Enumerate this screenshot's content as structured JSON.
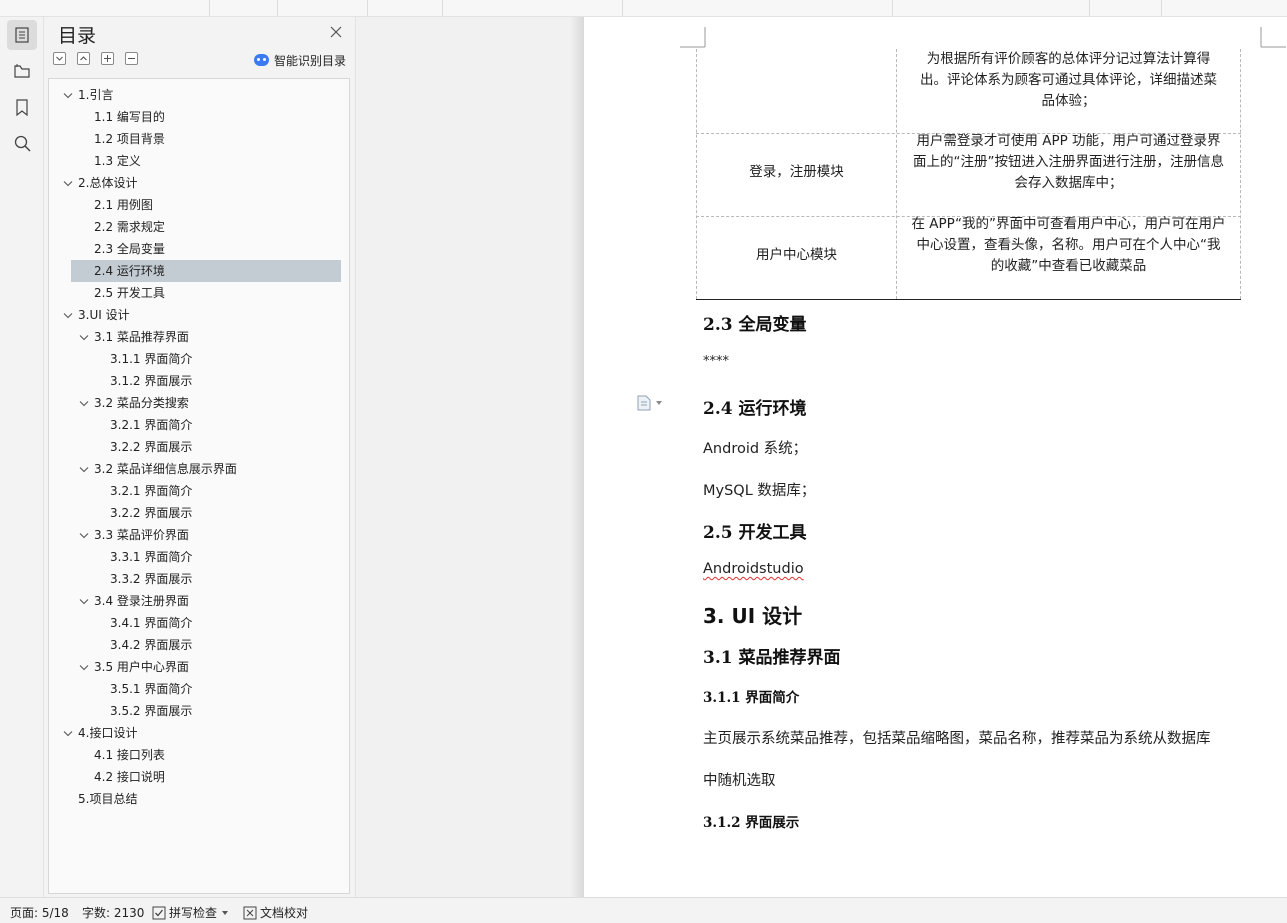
{
  "toc": {
    "title": "目录",
    "smart_label": "智能识别目录",
    "items": [
      {
        "label": "1.引言",
        "level": 0,
        "expanded": true
      },
      {
        "label": "1.1 编写目的",
        "level": 1
      },
      {
        "label": "1.2 项目背景",
        "level": 1
      },
      {
        "label": "1.3 定义",
        "level": 1
      },
      {
        "label": "2.总体设计",
        "level": 0,
        "expanded": true
      },
      {
        "label": "2.1 用例图",
        "level": 1
      },
      {
        "label": "2.2 需求规定",
        "level": 1
      },
      {
        "label": "2.3 全局变量",
        "level": 1
      },
      {
        "label": "2.4 运行环境",
        "level": 1,
        "selected": true
      },
      {
        "label": "2.5 开发工具",
        "level": 1
      },
      {
        "label": "3.UI 设计",
        "level": 0,
        "expanded": true
      },
      {
        "label": "3.1 菜品推荐界面",
        "level": 1,
        "expanded": true
      },
      {
        "label": "3.1.1 界面简介",
        "level": 2
      },
      {
        "label": "3.1.2 界面展示",
        "level": 2
      },
      {
        "label": "3.2 菜品分类搜索",
        "level": 1,
        "expanded": true
      },
      {
        "label": "3.2.1 界面简介",
        "level": 2
      },
      {
        "label": "3.2.2 界面展示",
        "level": 2
      },
      {
        "label": "3.2 菜品详细信息展示界面",
        "level": 1,
        "expanded": true
      },
      {
        "label": "3.2.1 界面简介",
        "level": 2
      },
      {
        "label": "3.2.2 界面展示",
        "level": 2
      },
      {
        "label": "3.3 菜品评价界面",
        "level": 1,
        "expanded": true
      },
      {
        "label": "3.3.1 界面简介",
        "level": 2
      },
      {
        "label": "3.3.2 界面展示",
        "level": 2
      },
      {
        "label": "3.4 登录注册界面",
        "level": 1,
        "expanded": true
      },
      {
        "label": "3.4.1 界面简介",
        "level": 2
      },
      {
        "label": "3.4.2 界面展示",
        "level": 2
      },
      {
        "label": "3.5 用户中心界面",
        "level": 1,
        "expanded": true
      },
      {
        "label": "3.5.1 界面简介",
        "level": 2
      },
      {
        "label": "3.5.2 界面展示",
        "level": 2
      },
      {
        "label": "4.接口设计",
        "level": 0,
        "expanded": true
      },
      {
        "label": "4.1 接口列表",
        "level": 1
      },
      {
        "label": "4.2 接口说明",
        "level": 1
      },
      {
        "label": "5.项目总结",
        "level": 0
      }
    ]
  },
  "doc": {
    "table": {
      "row0_desc": [
        "为根据所有评价顾客的总体评分记过算法计算得",
        "出。评论体系为顾客可通过具体评论，详细描述菜",
        "品体验；"
      ],
      "row1_name": "登录，注册模块",
      "row1_desc": [
        "用户需登录才可使用 APP 功能，用户可通过登录界",
        "面上的“注册”按钮进入注册界面进行注册，注册信息",
        "会存入数据库中；"
      ],
      "row2_name": "用户中心模块",
      "row2_desc": [
        "在 APP“我的”界面中可查看用户中心，用户可在用户",
        "中心设置，查看头像，名称。用户可在个人中心“我",
        "的收藏”中查看已收藏菜品"
      ]
    },
    "h_2_3": "2.3 全局变量",
    "p_stars": "****",
    "h_2_4": "2.4 运行环境",
    "p_android": "Android 系统；",
    "p_mysql": "MySQL 数据库；",
    "h_2_5": "2.5 开发工具",
    "p_studio": "Androidstudio",
    "h_3": "3. UI 设计",
    "h_3_1": "3.1 菜品推荐界面",
    "h_3_1_1": "3.1.1 界面简介",
    "p_intro_1": "主页展示系统菜品推荐，包括菜品缩略图，菜品名称，推荐菜品为系统从数据库",
    "p_intro_2": "中随机选取",
    "h_3_1_2": "3.1.2 界面展示"
  },
  "status": {
    "page": "页面: 5/18",
    "words": "字数: 2130",
    "spell": "拼写检查",
    "proof": "文档校对"
  }
}
